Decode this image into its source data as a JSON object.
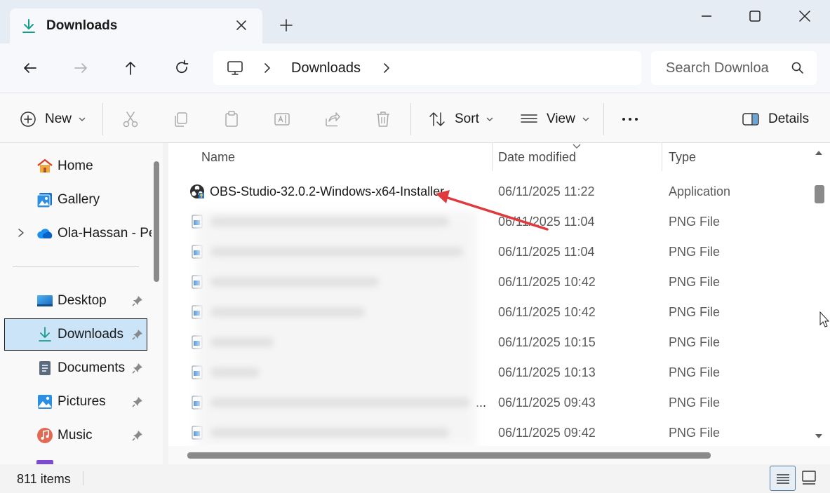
{
  "tab": {
    "title": "Downloads",
    "icon": "download-icon"
  },
  "address": {
    "segments": [
      "Downloads"
    ]
  },
  "search": {
    "placeholder": "Search Downloa"
  },
  "toolbar": {
    "new_label": "New",
    "sort_label": "Sort",
    "view_label": "View",
    "details_label": "Details"
  },
  "sidebar": {
    "items": [
      {
        "label": "Home",
        "icon": "home-icon"
      },
      {
        "label": "Gallery",
        "icon": "gallery-icon"
      },
      {
        "label": "Ola-Hassan - Per",
        "icon": "cloud-icon"
      },
      {
        "label": "Desktop",
        "icon": "desktop-icon"
      },
      {
        "label": "Downloads",
        "icon": "download-icon"
      },
      {
        "label": "Documents",
        "icon": "documents-icon"
      },
      {
        "label": "Pictures",
        "icon": "pictures-icon"
      },
      {
        "label": "Music",
        "icon": "music-icon"
      }
    ]
  },
  "columns": {
    "name": "Name",
    "date": "Date modified",
    "type": "Type"
  },
  "files": [
    {
      "name": "OBS-Studio-32.0.2-Windows-x64-Installer",
      "date": "06/11/2025 11:22",
      "type": "Application"
    },
    {
      "name": "",
      "date": "06/11/2025 11:04",
      "type": "PNG File"
    },
    {
      "name": "",
      "date": "06/11/2025 11:04",
      "type": "PNG File"
    },
    {
      "name": "",
      "date": "06/11/2025 10:42",
      "type": "PNG File"
    },
    {
      "name": "",
      "date": "06/11/2025 10:42",
      "type": "PNG File"
    },
    {
      "name": "",
      "date": "06/11/2025 10:15",
      "type": "PNG File"
    },
    {
      "name": "",
      "date": "06/11/2025 10:13",
      "type": "PNG File"
    },
    {
      "name": "...",
      "date": "06/11/2025 09:43",
      "type": "PNG File"
    },
    {
      "name": "",
      "date": "06/11/2025 09:42",
      "type": "PNG File"
    }
  ],
  "status": {
    "item_count": "811 items"
  },
  "colors": {
    "accent": "#0f9d8a",
    "selection": "#cce4f7",
    "annotation_arrow": "#e0393e"
  }
}
